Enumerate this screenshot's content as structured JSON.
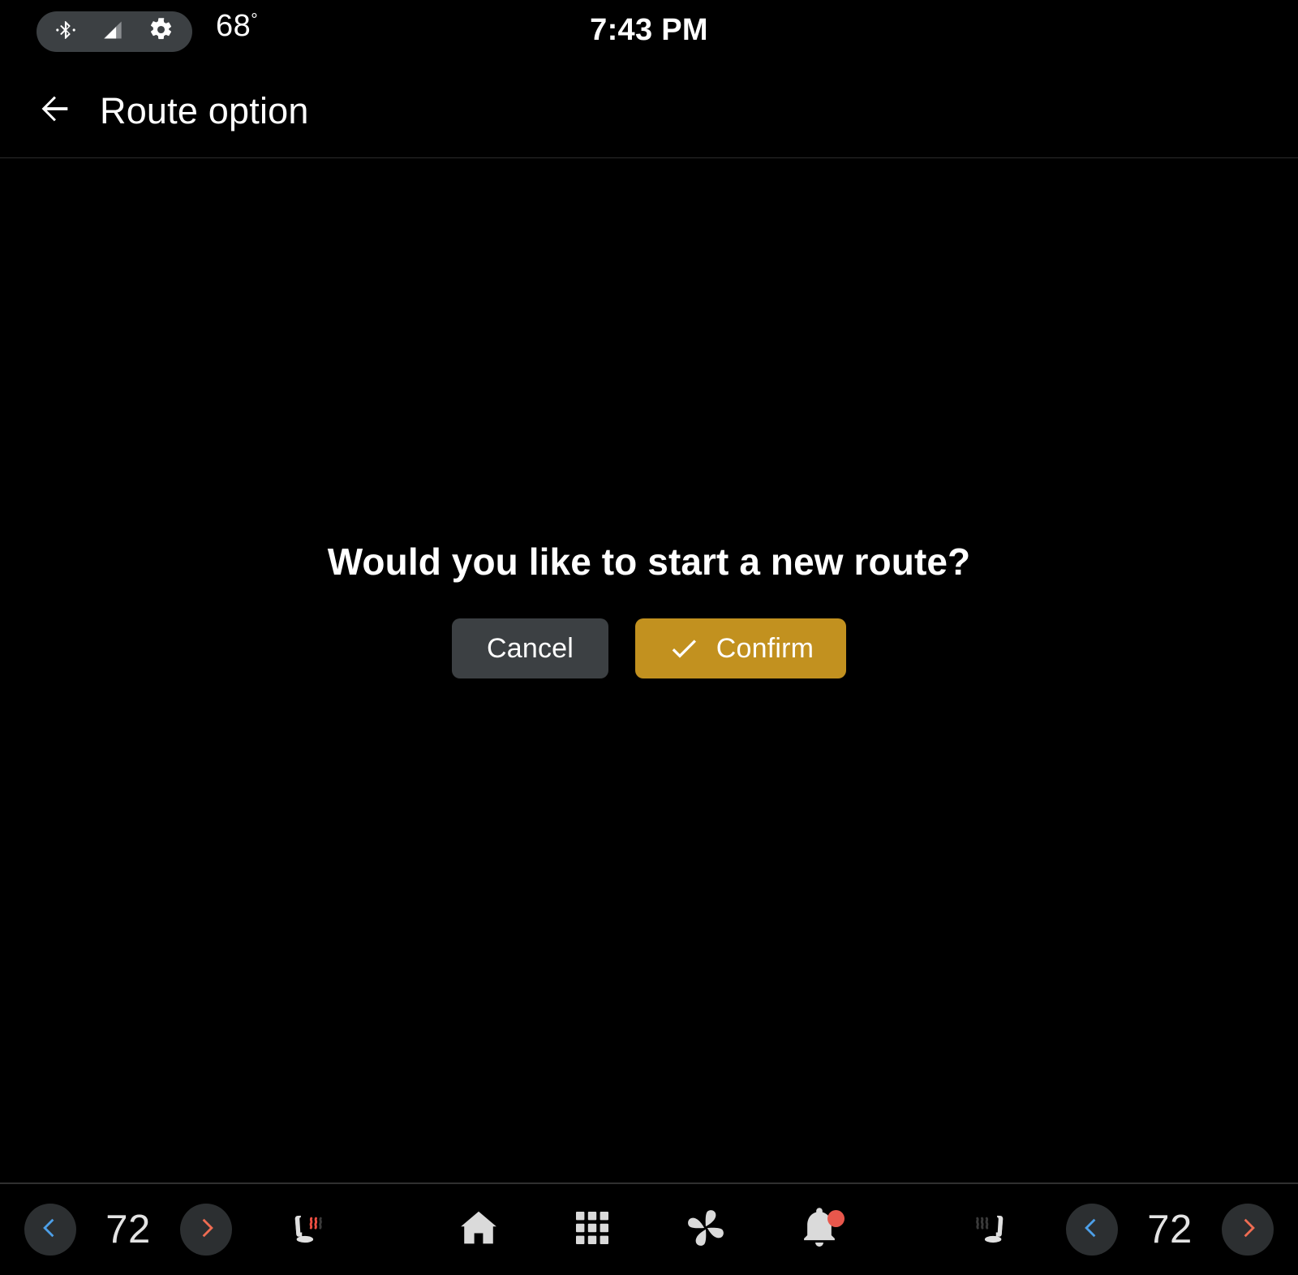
{
  "status_bar": {
    "icons": [
      "bluetooth-icon",
      "signal-icon",
      "gear-icon"
    ],
    "outside_temp": "68",
    "degree_symbol": "°",
    "clock": "7:43 PM"
  },
  "header": {
    "back_icon": "back-arrow-icon",
    "title": "Route option"
  },
  "dialog": {
    "message": "Would you like to start a new route?",
    "cancel_label": "Cancel",
    "confirm_label": "Confirm",
    "confirm_icon": "check-icon",
    "cancel_color": "#3c4043",
    "confirm_color": "#c2911f"
  },
  "nav_bar": {
    "climate_left": {
      "decrease_icon": "chevron-left-icon",
      "temperature": "72",
      "increase_icon": "chevron-right-icon",
      "seat_icon": "heated-seat-icon",
      "seat_heat_active": true
    },
    "climate_right": {
      "seat_icon": "heated-seat-icon",
      "seat_heat_active": false,
      "decrease_icon": "chevron-left-icon",
      "temperature": "72",
      "increase_icon": "chevron-right-icon"
    },
    "center_items": [
      {
        "name": "home-icon",
        "label": "Home"
      },
      {
        "name": "apps-grid-icon",
        "label": "Apps"
      },
      {
        "name": "fan-icon",
        "label": "Climate"
      },
      {
        "name": "notifications-bell-icon",
        "label": "Notifications",
        "badge": true
      }
    ],
    "colors": {
      "decrease_chevron": "#4d9fe8",
      "increase_chevron": "#ef6c52",
      "circle_bg": "#2c2f31",
      "icon": "#dadada",
      "badge": "#e8574c",
      "heat_active": "#ee4f42",
      "heat_inactive": "#3a3a3a"
    }
  }
}
